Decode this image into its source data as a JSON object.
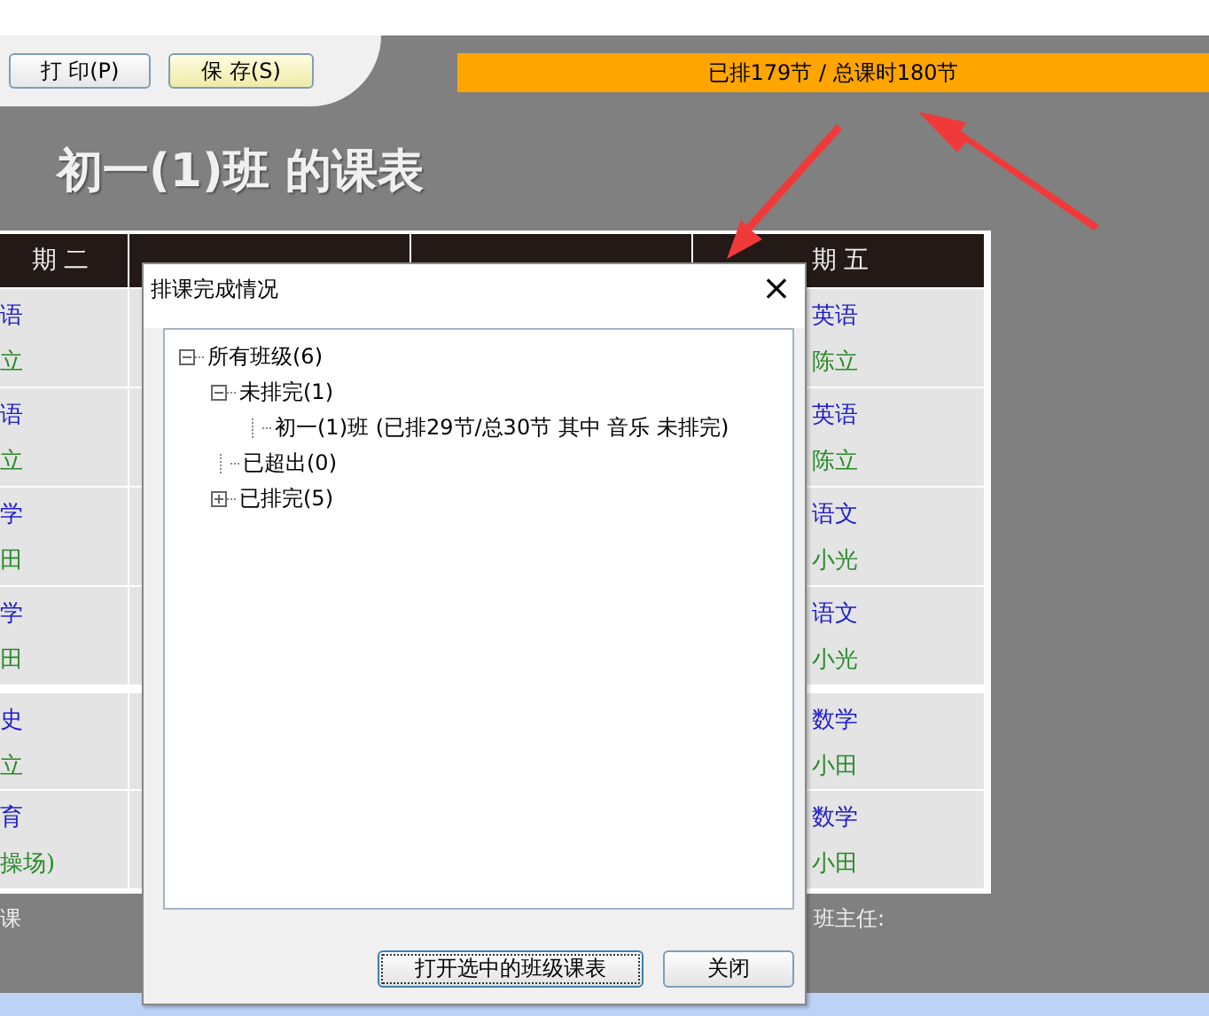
{
  "toolbar": {
    "buttons": [
      {
        "label": "打 印(P)",
        "kind": "plain"
      },
      {
        "label": "保 存(S)",
        "kind": "highlight"
      }
    ]
  },
  "progress_banner": "已排179节 / 总课时180节",
  "title": "初一(1)班 的课表",
  "timetable": {
    "columns": {
      "tuesday": "期二",
      "friday": "期五"
    },
    "rows": [
      {
        "tuesday": {
          "subject": "语",
          "teacher": "立"
        },
        "friday": {
          "subject": "英语",
          "teacher": "陈立"
        }
      },
      {
        "tuesday": {
          "subject": "语",
          "teacher": "立"
        },
        "friday": {
          "subject": "英语",
          "teacher": "陈立"
        }
      },
      {
        "tuesday": {
          "subject": "学",
          "teacher": "田"
        },
        "friday": {
          "subject": "语文",
          "teacher": "小光"
        }
      },
      {
        "tuesday": {
          "subject": "学",
          "teacher": "田"
        },
        "friday": {
          "subject": "语文",
          "teacher": "小光"
        }
      },
      {
        "tuesday": {
          "subject": "史",
          "teacher": "立"
        },
        "friday": {
          "subject": "数学",
          "teacher": "小田"
        }
      },
      {
        "tuesday": {
          "subject": "育",
          "teacher": "操场)"
        },
        "friday": {
          "subject": "数学",
          "teacher": "小田"
        }
      }
    ],
    "footer_left": "课",
    "footer_right": "班主任:"
  },
  "dialog": {
    "title": "排课完成情况",
    "close": "×",
    "tree": [
      {
        "label": "所有班级(6)",
        "expanded": true,
        "children": [
          {
            "label": "未排完(1)",
            "expanded": true,
            "children": [
              {
                "label": "初一(1)班 (已排29节/总30节 其中 音乐 未排完)"
              }
            ]
          },
          {
            "label": "已超出(0)"
          },
          {
            "label": "已排完(5)",
            "expanded": false
          }
        ]
      }
    ],
    "buttons": [
      {
        "label": "打开选中的班级课表",
        "kind": "default"
      },
      {
        "label": "关闭",
        "kind": "plain"
      }
    ]
  }
}
